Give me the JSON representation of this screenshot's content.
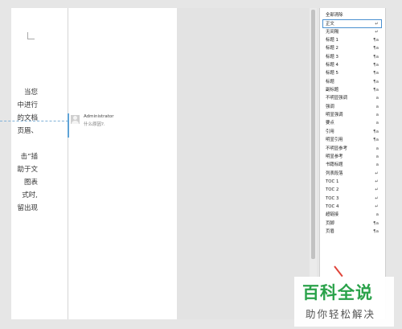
{
  "document": {
    "lines": [
      "当您",
      "中进行",
      "的文档",
      "页眉、",
      "击“插",
      "助于文",
      "图表",
      "式时,",
      "留出现"
    ]
  },
  "comment": {
    "author": "Administrator",
    "text": "什么原因?."
  },
  "styles_pane": {
    "items": [
      {
        "label": "全部清除",
        "mark": ""
      },
      {
        "label": "正文",
        "mark": "↵",
        "selected": true
      },
      {
        "label": "无间隔",
        "mark": "↵"
      },
      {
        "label": "标题 1",
        "mark": "¶a"
      },
      {
        "label": "标题 2",
        "mark": "¶a"
      },
      {
        "label": "标题 3",
        "mark": "¶a"
      },
      {
        "label": "标题 4",
        "mark": "¶a"
      },
      {
        "label": "标题 5",
        "mark": "¶a"
      },
      {
        "label": "标题",
        "mark": "¶a"
      },
      {
        "label": "副标题",
        "mark": "¶a"
      },
      {
        "label": "不明显强调",
        "mark": "a"
      },
      {
        "label": "强调",
        "mark": "a"
      },
      {
        "label": "明显强调",
        "mark": "a"
      },
      {
        "label": "要点",
        "mark": "a"
      },
      {
        "label": "引用",
        "mark": "¶a"
      },
      {
        "label": "明显引用",
        "mark": "¶a"
      },
      {
        "label": "不明显参考",
        "mark": "a"
      },
      {
        "label": "明显参考",
        "mark": "a"
      },
      {
        "label": "书籍标题",
        "mark": "a"
      },
      {
        "label": "列表段落",
        "mark": "↵"
      },
      {
        "label": "TOC 1",
        "mark": "↵"
      },
      {
        "label": "TOC 2",
        "mark": "↵"
      },
      {
        "label": "TOC 3",
        "mark": "↵"
      },
      {
        "label": "TOC 4",
        "mark": "↵"
      },
      {
        "label": "超链接",
        "mark": "a"
      },
      {
        "label": "页脚",
        "mark": "¶a"
      },
      {
        "label": "页眉",
        "mark": "¶a"
      }
    ]
  },
  "watermark": {
    "title": "百科全说",
    "subtitle": "助你轻松解决"
  },
  "colors": {
    "accent": "#4a90d0",
    "comment_marker": "#5ea3d6",
    "pointer": "#e0443a",
    "watermark_green": "#2aa24a"
  }
}
